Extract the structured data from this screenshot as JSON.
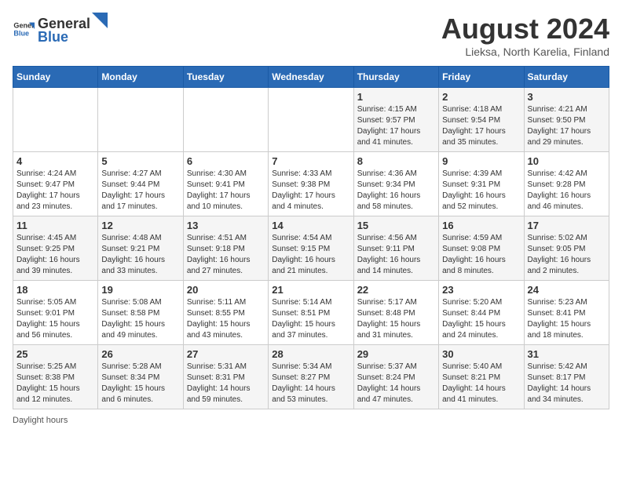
{
  "header": {
    "logo_general": "General",
    "logo_blue": "Blue",
    "main_title": "August 2024",
    "subtitle": "Lieksa, North Karelia, Finland"
  },
  "days_of_week": [
    "Sunday",
    "Monday",
    "Tuesday",
    "Wednesday",
    "Thursday",
    "Friday",
    "Saturday"
  ],
  "weeks": [
    [
      {
        "day": "",
        "info": ""
      },
      {
        "day": "",
        "info": ""
      },
      {
        "day": "",
        "info": ""
      },
      {
        "day": "",
        "info": ""
      },
      {
        "day": "1",
        "info": "Sunrise: 4:15 AM\nSunset: 9:57 PM\nDaylight: 17 hours\nand 41 minutes."
      },
      {
        "day": "2",
        "info": "Sunrise: 4:18 AM\nSunset: 9:54 PM\nDaylight: 17 hours\nand 35 minutes."
      },
      {
        "day": "3",
        "info": "Sunrise: 4:21 AM\nSunset: 9:50 PM\nDaylight: 17 hours\nand 29 minutes."
      }
    ],
    [
      {
        "day": "4",
        "info": "Sunrise: 4:24 AM\nSunset: 9:47 PM\nDaylight: 17 hours\nand 23 minutes."
      },
      {
        "day": "5",
        "info": "Sunrise: 4:27 AM\nSunset: 9:44 PM\nDaylight: 17 hours\nand 17 minutes."
      },
      {
        "day": "6",
        "info": "Sunrise: 4:30 AM\nSunset: 9:41 PM\nDaylight: 17 hours\nand 10 minutes."
      },
      {
        "day": "7",
        "info": "Sunrise: 4:33 AM\nSunset: 9:38 PM\nDaylight: 17 hours\nand 4 minutes."
      },
      {
        "day": "8",
        "info": "Sunrise: 4:36 AM\nSunset: 9:34 PM\nDaylight: 16 hours\nand 58 minutes."
      },
      {
        "day": "9",
        "info": "Sunrise: 4:39 AM\nSunset: 9:31 PM\nDaylight: 16 hours\nand 52 minutes."
      },
      {
        "day": "10",
        "info": "Sunrise: 4:42 AM\nSunset: 9:28 PM\nDaylight: 16 hours\nand 46 minutes."
      }
    ],
    [
      {
        "day": "11",
        "info": "Sunrise: 4:45 AM\nSunset: 9:25 PM\nDaylight: 16 hours\nand 39 minutes."
      },
      {
        "day": "12",
        "info": "Sunrise: 4:48 AM\nSunset: 9:21 PM\nDaylight: 16 hours\nand 33 minutes."
      },
      {
        "day": "13",
        "info": "Sunrise: 4:51 AM\nSunset: 9:18 PM\nDaylight: 16 hours\nand 27 minutes."
      },
      {
        "day": "14",
        "info": "Sunrise: 4:54 AM\nSunset: 9:15 PM\nDaylight: 16 hours\nand 21 minutes."
      },
      {
        "day": "15",
        "info": "Sunrise: 4:56 AM\nSunset: 9:11 PM\nDaylight: 16 hours\nand 14 minutes."
      },
      {
        "day": "16",
        "info": "Sunrise: 4:59 AM\nSunset: 9:08 PM\nDaylight: 16 hours\nand 8 minutes."
      },
      {
        "day": "17",
        "info": "Sunrise: 5:02 AM\nSunset: 9:05 PM\nDaylight: 16 hours\nand 2 minutes."
      }
    ],
    [
      {
        "day": "18",
        "info": "Sunrise: 5:05 AM\nSunset: 9:01 PM\nDaylight: 15 hours\nand 56 minutes."
      },
      {
        "day": "19",
        "info": "Sunrise: 5:08 AM\nSunset: 8:58 PM\nDaylight: 15 hours\nand 49 minutes."
      },
      {
        "day": "20",
        "info": "Sunrise: 5:11 AM\nSunset: 8:55 PM\nDaylight: 15 hours\nand 43 minutes."
      },
      {
        "day": "21",
        "info": "Sunrise: 5:14 AM\nSunset: 8:51 PM\nDaylight: 15 hours\nand 37 minutes."
      },
      {
        "day": "22",
        "info": "Sunrise: 5:17 AM\nSunset: 8:48 PM\nDaylight: 15 hours\nand 31 minutes."
      },
      {
        "day": "23",
        "info": "Sunrise: 5:20 AM\nSunset: 8:44 PM\nDaylight: 15 hours\nand 24 minutes."
      },
      {
        "day": "24",
        "info": "Sunrise: 5:23 AM\nSunset: 8:41 PM\nDaylight: 15 hours\nand 18 minutes."
      }
    ],
    [
      {
        "day": "25",
        "info": "Sunrise: 5:25 AM\nSunset: 8:38 PM\nDaylight: 15 hours\nand 12 minutes."
      },
      {
        "day": "26",
        "info": "Sunrise: 5:28 AM\nSunset: 8:34 PM\nDaylight: 15 hours\nand 6 minutes."
      },
      {
        "day": "27",
        "info": "Sunrise: 5:31 AM\nSunset: 8:31 PM\nDaylight: 14 hours\nand 59 minutes."
      },
      {
        "day": "28",
        "info": "Sunrise: 5:34 AM\nSunset: 8:27 PM\nDaylight: 14 hours\nand 53 minutes."
      },
      {
        "day": "29",
        "info": "Sunrise: 5:37 AM\nSunset: 8:24 PM\nDaylight: 14 hours\nand 47 minutes."
      },
      {
        "day": "30",
        "info": "Sunrise: 5:40 AM\nSunset: 8:21 PM\nDaylight: 14 hours\nand 41 minutes."
      },
      {
        "day": "31",
        "info": "Sunrise: 5:42 AM\nSunset: 8:17 PM\nDaylight: 14 hours\nand 34 minutes."
      }
    ]
  ],
  "footer": {
    "daylight_label": "Daylight hours"
  }
}
